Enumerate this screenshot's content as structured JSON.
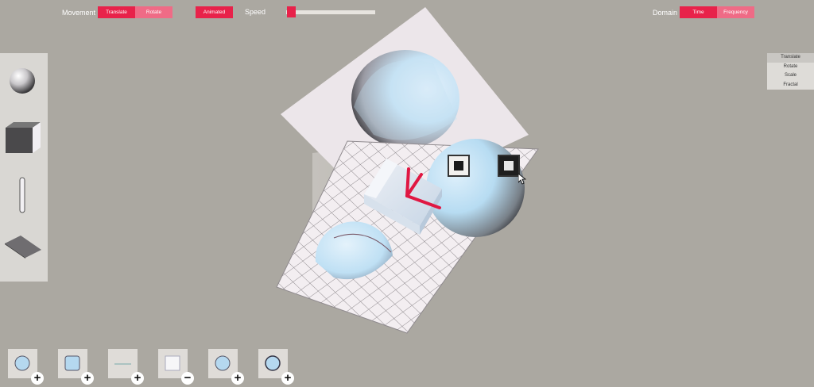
{
  "toolbar": {
    "movement_label": "Movement",
    "movement_options": [
      "Translate",
      "Rotate"
    ],
    "animated_label": "Animated",
    "speed_label": "Speed",
    "speed_value": 0.05,
    "domain_label": "Domain",
    "domain_options": [
      "Time",
      "Frequency"
    ]
  },
  "right_menu": {
    "items": [
      "Translate",
      "Rotate",
      "Scale",
      "Fractal"
    ],
    "selected": "Translate"
  },
  "left_panel": {
    "items": [
      "sphere-icon",
      "cube-icon",
      "cylinder-icon",
      "plane-icon"
    ]
  },
  "bottom_toolbar": {
    "tools": [
      {
        "name": "add-sphere",
        "sign": "+"
      },
      {
        "name": "add-cube",
        "sign": "+"
      },
      {
        "name": "add-plane",
        "sign": "+"
      },
      {
        "name": "remove-object",
        "sign": "−"
      },
      {
        "name": "add-sphere-2",
        "sign": "+"
      },
      {
        "name": "add-sphere-3",
        "sign": "+"
      }
    ]
  },
  "colors": {
    "accent": "#e8224a",
    "accent_light": "#ef6b86",
    "background": "#aba8a1",
    "panel": "#d9d7d3"
  }
}
